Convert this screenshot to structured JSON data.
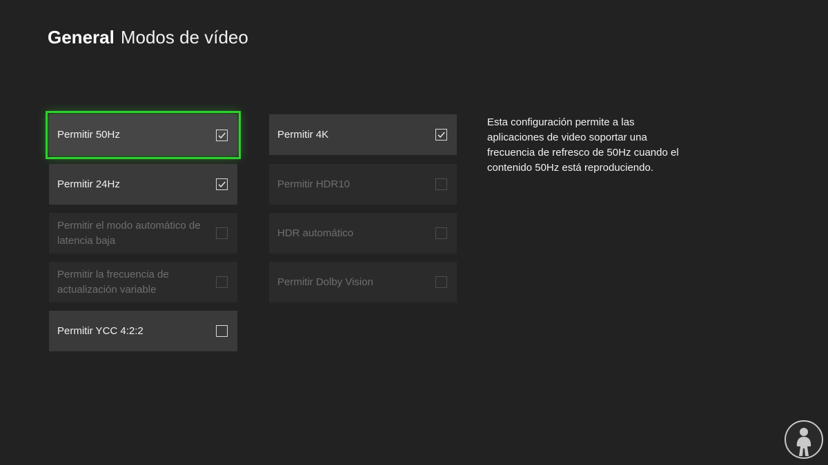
{
  "header": {
    "section": "General",
    "page": "Modos de vídeo"
  },
  "left_column": [
    {
      "label": "Permitir 50Hz",
      "checked": true,
      "enabled": true,
      "focused": true
    },
    {
      "label": "Permitir 24Hz",
      "checked": true,
      "enabled": true,
      "focused": false
    },
    {
      "label": "Permitir el modo automático de latencia baja",
      "checked": false,
      "enabled": false,
      "focused": false
    },
    {
      "label": "Permitir la frecuencia de actualización variable",
      "checked": false,
      "enabled": false,
      "focused": false
    },
    {
      "label": "Permitir YCC 4:2:2",
      "checked": false,
      "enabled": true,
      "focused": false
    }
  ],
  "right_column": [
    {
      "label": "Permitir 4K",
      "checked": true,
      "enabled": true,
      "focused": false
    },
    {
      "label": "Permitir HDR10",
      "checked": false,
      "enabled": false,
      "focused": false
    },
    {
      "label": "HDR automático",
      "checked": false,
      "enabled": false,
      "focused": false
    },
    {
      "label": "Permitir Dolby Vision",
      "checked": false,
      "enabled": false,
      "focused": false
    }
  ],
  "description": "Esta configuración permite a las aplicaciones de video soportar una frecuencia de refresco de 50Hz cuando el contenido 50Hz está reproduciendo.",
  "colors": {
    "background": "#222222",
    "focus": "#2fd02f",
    "tile": "#3a3a3a",
    "tile_disabled": "#2b2b2b",
    "watermark": "#c9c9c9"
  },
  "watermark_icon": "woman-silhouette-logo-icon"
}
